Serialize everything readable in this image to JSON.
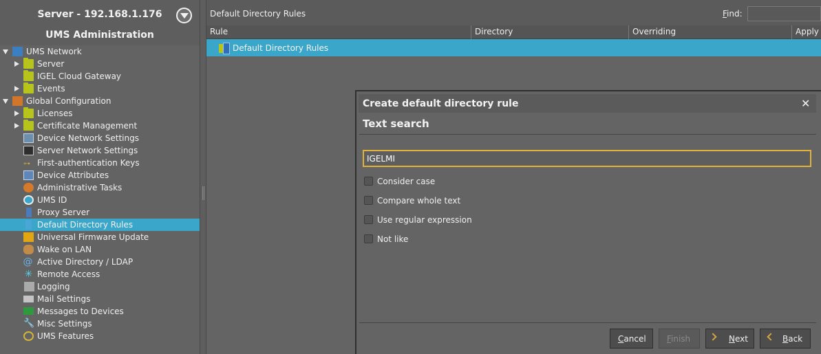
{
  "sidebar": {
    "server_title": "Server - 192.168.1.176",
    "ums_title": "UMS Administration",
    "tree": [
      {
        "label": "UMS Network",
        "icon": "ums-network-icon",
        "expand": "down",
        "depth": 0
      },
      {
        "label": "Server",
        "icon": "folder-icon",
        "expand": "right",
        "depth": 1
      },
      {
        "label": "IGEL Cloud Gateway",
        "icon": "folder-icon",
        "expand": "",
        "depth": 1
      },
      {
        "label": "Events",
        "icon": "folder-icon",
        "expand": "right",
        "depth": 1
      },
      {
        "label": "Global Configuration",
        "icon": "global-configuration-icon",
        "expand": "down",
        "depth": 0
      },
      {
        "label": "Licenses",
        "icon": "folder-icon",
        "expand": "right",
        "depth": 1
      },
      {
        "label": "Certificate Management",
        "icon": "folder-icon",
        "expand": "right",
        "depth": 1
      },
      {
        "label": "Device Network Settings",
        "icon": "monitor-icon",
        "expand": "",
        "depth": 1
      },
      {
        "label": "Server Network Settings",
        "icon": "server-icon",
        "expand": "",
        "depth": 1
      },
      {
        "label": "First-authentication Keys",
        "icon": "key-icon",
        "expand": "",
        "depth": 1
      },
      {
        "label": "Device Attributes",
        "icon": "attributes-icon",
        "expand": "",
        "depth": 1
      },
      {
        "label": "Administrative Tasks",
        "icon": "clock-icon",
        "expand": "",
        "depth": 1
      },
      {
        "label": "UMS ID",
        "icon": "ums-id-icon",
        "expand": "",
        "depth": 1
      },
      {
        "label": "Proxy Server",
        "icon": "proxy-icon",
        "expand": "",
        "depth": 1
      },
      {
        "label": "Default Directory Rules",
        "icon": "directory-rules-icon",
        "expand": "",
        "depth": 1,
        "selected": true
      },
      {
        "label": "Universal Firmware Update",
        "icon": "firmware-icon",
        "expand": "",
        "depth": 1
      },
      {
        "label": "Wake on LAN",
        "icon": "wake-on-lan-icon",
        "expand": "",
        "depth": 1
      },
      {
        "label": "Active Directory / LDAP",
        "icon": "at-sign-icon",
        "expand": "",
        "depth": 1
      },
      {
        "label": "Remote Access",
        "icon": "remote-access-icon",
        "expand": "",
        "depth": 1
      },
      {
        "label": "Logging",
        "icon": "log-icon",
        "expand": "",
        "depth": 1
      },
      {
        "label": "Mail Settings",
        "icon": "mail-icon",
        "expand": "",
        "depth": 1
      },
      {
        "label": "Messages to Devices",
        "icon": "message-icon",
        "expand": "",
        "depth": 1
      },
      {
        "label": "Misc Settings",
        "icon": "wrench-icon",
        "expand": "",
        "depth": 1
      },
      {
        "label": "UMS Features",
        "icon": "gear-icon",
        "expand": "",
        "depth": 1
      }
    ]
  },
  "main": {
    "title": "Default Directory Rules",
    "find_label_mnemonic": "F",
    "find_label_rest": "ind:",
    "find_value": "",
    "columns": [
      "Rule",
      "Directory",
      "Overriding",
      "Apply on"
    ],
    "rows": [
      {
        "label": "Default Directory Rules"
      }
    ]
  },
  "dialog": {
    "title": "Create default directory rule",
    "close_glyph": "✕",
    "subtitle": "Text search",
    "search_value": "IGELMI",
    "options": [
      {
        "label": "Consider case",
        "checked": false
      },
      {
        "label": "Compare whole text",
        "checked": false
      },
      {
        "label": "Use regular expression",
        "checked": false
      },
      {
        "label": "Not like",
        "checked": false
      }
    ],
    "buttons": {
      "cancel_mnemonic": "C",
      "cancel_rest": "ancel",
      "finish_mnemonic": "F",
      "finish_rest": "inish",
      "next_mnemonic": "N",
      "next_rest": "ext",
      "back_mnemonic": "B",
      "back_rest": "ack"
    }
  },
  "colors": {
    "selection": "#3aa6c9",
    "focus_border": "#e2b23a",
    "folder": "#b7c41c"
  }
}
